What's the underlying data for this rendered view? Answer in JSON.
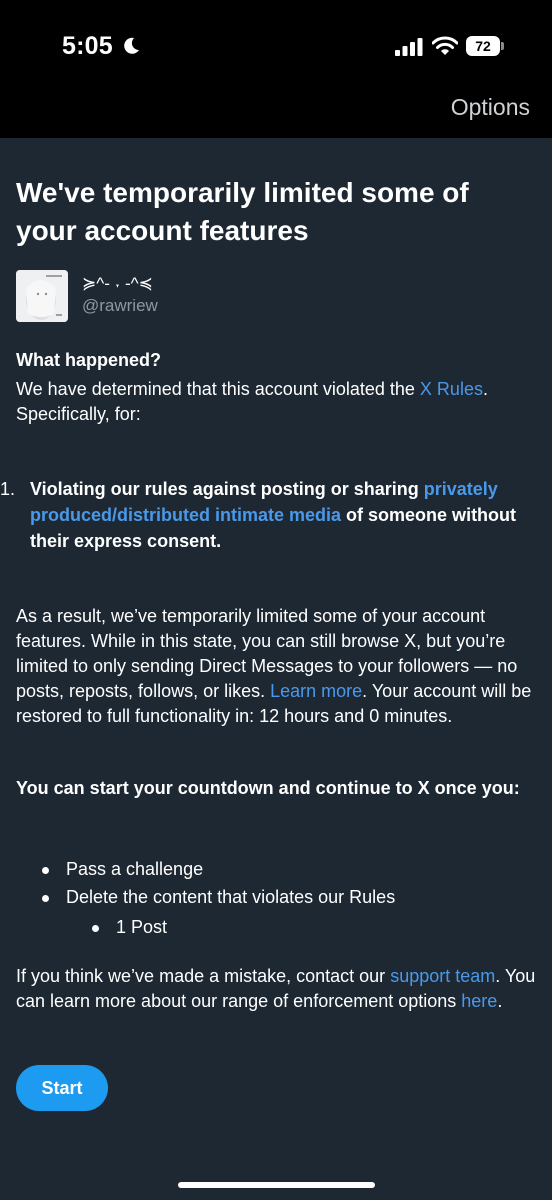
{
  "status_bar": {
    "time": "5:05",
    "battery": "72",
    "icons": [
      "moon-icon",
      "signal-icon",
      "wifi-icon",
      "battery-icon"
    ]
  },
  "header": {
    "options_label": "Options"
  },
  "page": {
    "title": "We've temporarily limited some of your account features"
  },
  "account": {
    "display_name": "≽^- ˕ -^≼",
    "handle": "@rawriew",
    "avatar": "avatar-image"
  },
  "what_happened": {
    "heading": "What happened?",
    "body_before_link": "We have determined that this account violated the ",
    "link": "X Rules",
    "body_after_link": ". Specifically, for:"
  },
  "violations": [
    {
      "number": "1.",
      "before_link": "Violating our rules against posting or sharing ",
      "link": "privately produced/distributed intimate media",
      "after_link": " of someone without their express consent."
    }
  ],
  "result": {
    "body_before_link": "As a result, we’ve temporarily limited some of your account features. While in this state, you can still browse X, but you’re limited to only sending Direct Messages to your followers — no posts, reposts, follows, or likes. ",
    "link": "Learn more",
    "body_after_link": ". Your account will be restored to full functionality in: 12 hours and 0 minutes."
  },
  "countdown": {
    "heading": "You can start your countdown and continue to X once you:",
    "items": [
      "Pass a challenge",
      "Delete the content that violates our Rules"
    ],
    "sub_items": [
      "1 Post"
    ]
  },
  "mistake": {
    "before_link1": "If you think we’ve made a mistake, contact our ",
    "link1": "support team",
    "middle": ". You can learn more about our range of enforcement options ",
    "link2": "here",
    "end": "."
  },
  "actions": {
    "start_label": "Start"
  },
  "colors": {
    "background": "#1e2833",
    "top_bar": "#000000",
    "link": "#4a99e9",
    "button": "#1d9bf0",
    "secondary_text": "#8b98a5"
  }
}
